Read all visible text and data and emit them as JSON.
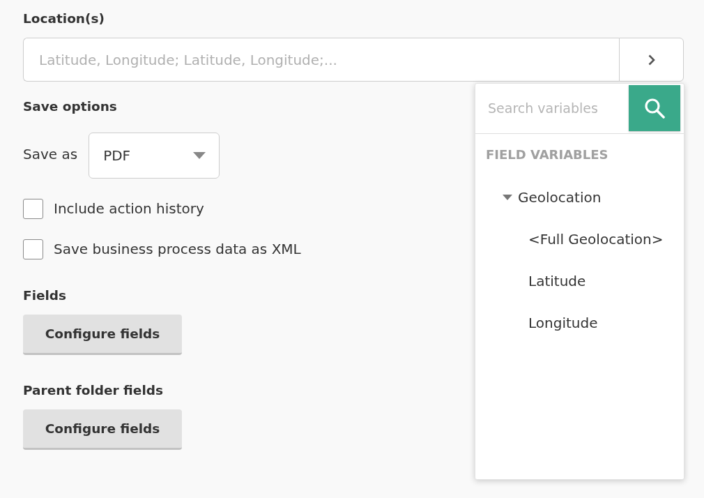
{
  "location": {
    "label": "Location(s)",
    "placeholder": "Latitude, Longitude; Latitude, Longitude;..."
  },
  "save_options": {
    "heading": "Save options",
    "save_as": {
      "label": "Save as",
      "value": "PDF"
    },
    "checkboxes": [
      {
        "label": "Include action history",
        "checked": false
      },
      {
        "label": "Save business process data as XML",
        "checked": false
      }
    ]
  },
  "fields": {
    "heading": "Fields",
    "button": "Configure fields"
  },
  "parent_folder_fields": {
    "heading": "Parent folder fields",
    "button": "Configure fields"
  },
  "variable_picker": {
    "search": {
      "placeholder": "Search variables"
    },
    "section": "FIELD VARIABLES",
    "tree": [
      {
        "label": "Geolocation",
        "expanded": true,
        "children": [
          {
            "label": "<Full Geolocation>"
          },
          {
            "label": "Latitude"
          },
          {
            "label": "Longitude"
          }
        ]
      }
    ]
  }
}
